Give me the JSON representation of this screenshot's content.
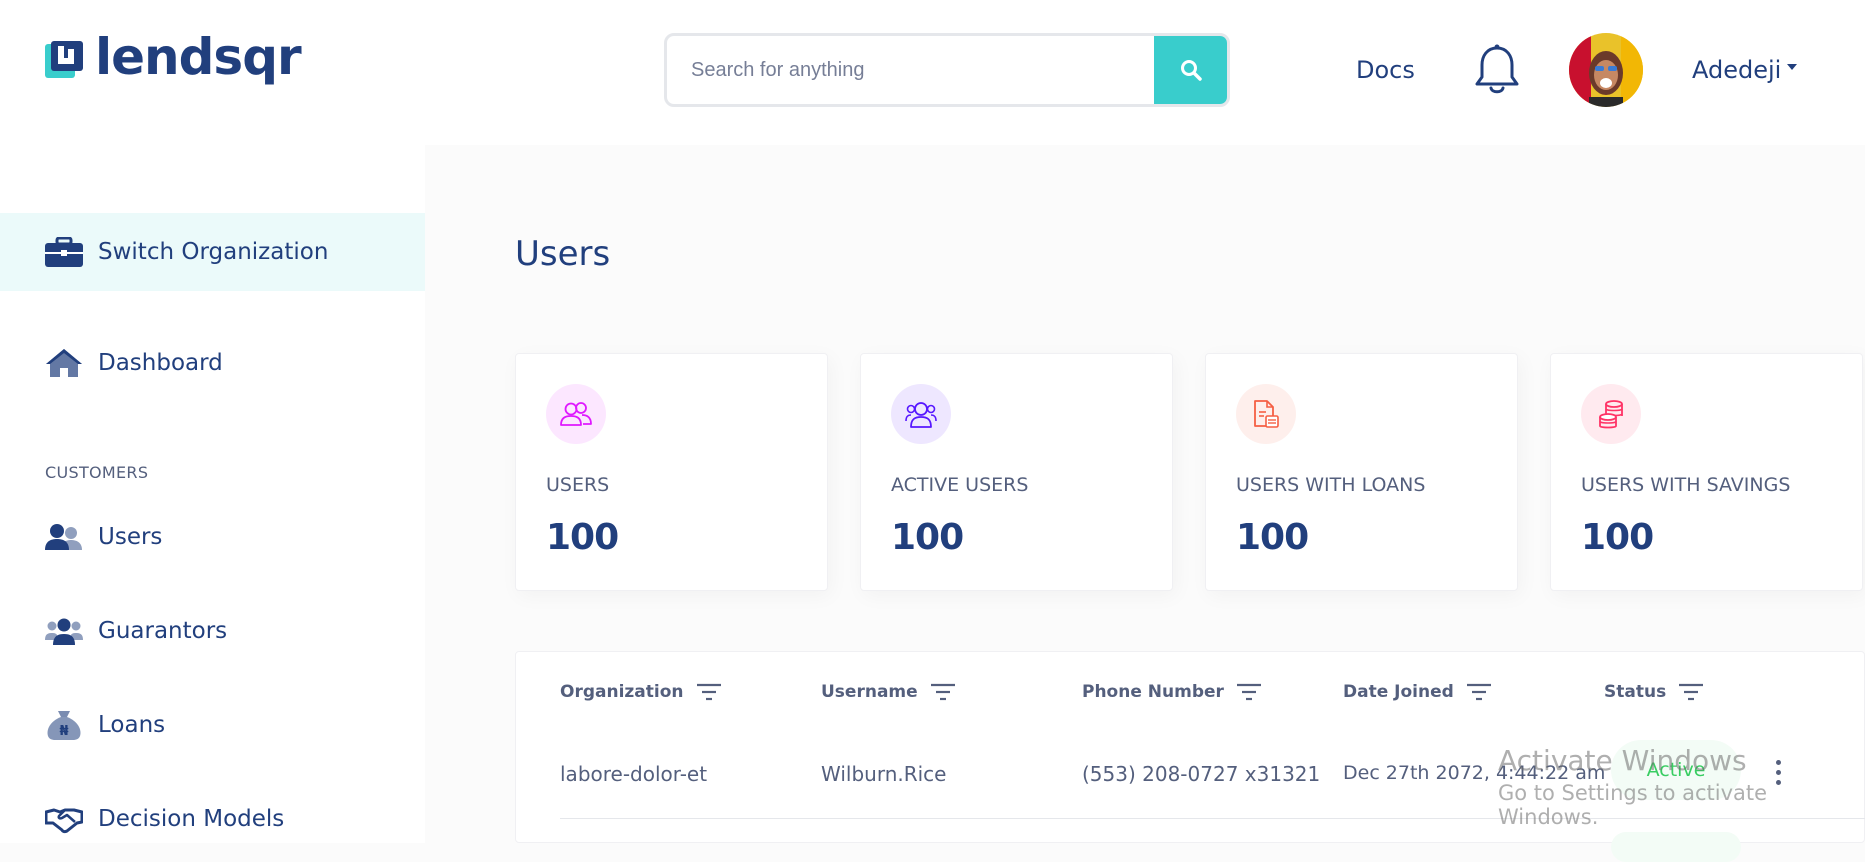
{
  "brand": {
    "name": "lendsqr",
    "color": "#213F7D",
    "accent": "#39CDCC"
  },
  "header": {
    "search_placeholder": "Search for anything",
    "docs_label": "Docs",
    "user_name": "Adedeji"
  },
  "sidebar": {
    "switch_org": "Switch Organization",
    "dashboard": "Dashboard",
    "section_customers": "CUSTOMERS",
    "items": [
      {
        "label": "Users",
        "icon": "users-icon"
      },
      {
        "label": "Guarantors",
        "icon": "guarantors-icon"
      },
      {
        "label": "Loans",
        "icon": "loan-sack-icon"
      },
      {
        "label": "Decision Models",
        "icon": "handshake-icon"
      }
    ]
  },
  "main": {
    "title": "Users",
    "cards": [
      {
        "label": "USERS",
        "value": "100",
        "icon": "users-outline-icon",
        "color": "#DF18FF"
      },
      {
        "label": "ACTIVE USERS",
        "value": "100",
        "icon": "active-users-icon",
        "color": "#5718FF"
      },
      {
        "label": "USERS WITH LOANS",
        "value": "100",
        "icon": "loan-document-icon",
        "color": "#F55F44"
      },
      {
        "label": "USERS WITH SAVINGS",
        "value": "100",
        "icon": "coins-icon",
        "color": "#FF3366"
      }
    ],
    "table": {
      "headers": [
        "Organization",
        "Username",
        "Phone Number",
        "Date Joined",
        "Status"
      ],
      "rows": [
        {
          "organization": "labore-dolor-et",
          "username": "Wilburn.Rice",
          "phone": "(553) 208-0727 x31321",
          "date_joined": "Dec 27th 2072, 4:44:22 am",
          "status": "Active"
        }
      ]
    }
  },
  "watermark": {
    "line1": "Activate Windows",
    "line2": "Go to Settings to activate Windows."
  }
}
